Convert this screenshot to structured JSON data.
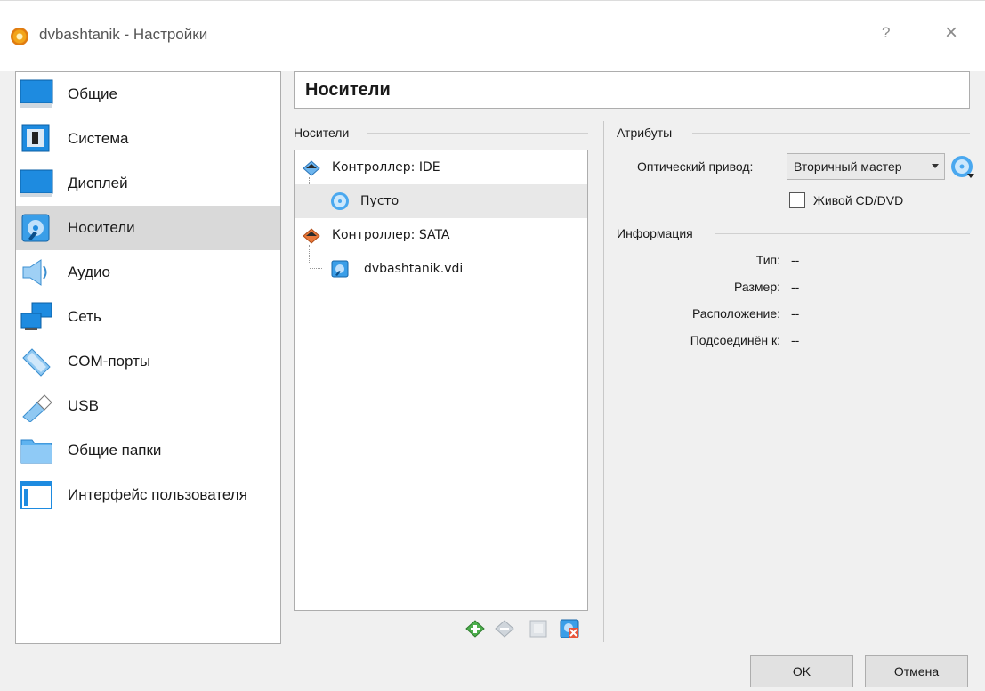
{
  "window": {
    "title": "dvbashtanik - Настройки",
    "help": "?",
    "close": "×"
  },
  "sidebar": {
    "items": [
      {
        "label": "Общие"
      },
      {
        "label": "Система"
      },
      {
        "label": "Дисплей"
      },
      {
        "label": "Носители"
      },
      {
        "label": "Аудио"
      },
      {
        "label": "Сеть"
      },
      {
        "label": "COM-порты"
      },
      {
        "label": "USB"
      },
      {
        "label": "Общие папки"
      },
      {
        "label": "Интерфейс пользователя"
      }
    ],
    "selected": "Носители"
  },
  "page": {
    "title": "Носители"
  },
  "storage": {
    "group_label": "Носители",
    "tree": [
      {
        "label": "Контроллер: IDE"
      },
      {
        "label": "Пусто"
      },
      {
        "label": "Контроллер: SATA"
      },
      {
        "label": "dvbashtanik.vdi"
      }
    ],
    "selected": "Пусто"
  },
  "attributes": {
    "group_label": "Атрибуты",
    "optical_drive_label": "Оптический привод:",
    "optical_drive_value": "Вторичный мастер",
    "live_cd_label": "Живой CD/DVD",
    "live_cd_checked": false
  },
  "information": {
    "group_label": "Информация",
    "rows": [
      {
        "key": "Тип:",
        "value": "--"
      },
      {
        "key": "Размер:",
        "value": "--"
      },
      {
        "key": "Расположение:",
        "value": "--"
      },
      {
        "key": "Подсоединён к:",
        "value": "--"
      }
    ]
  },
  "buttons": {
    "ok": "OK",
    "cancel": "Отмена"
  },
  "colors": {
    "selection": "#d9d9d9",
    "icon_blue": "#1e8be0"
  }
}
